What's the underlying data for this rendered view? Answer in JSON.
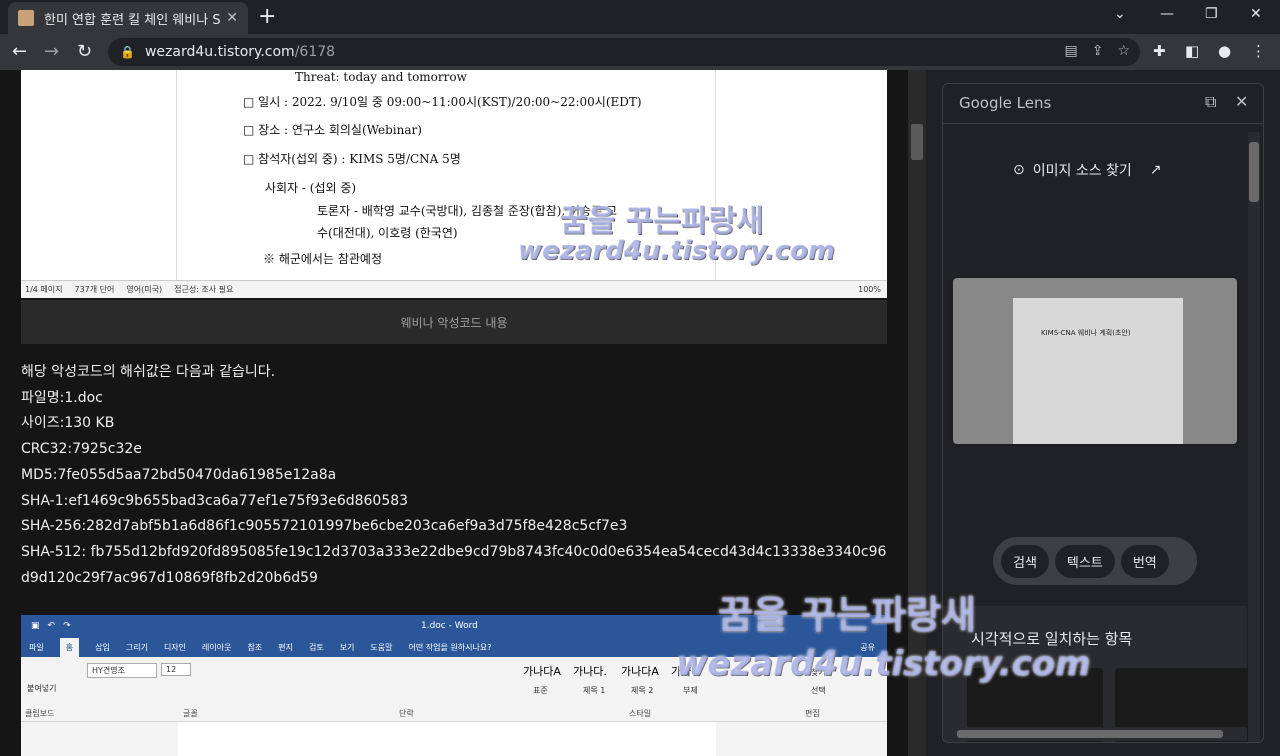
{
  "browser": {
    "tab_title": "한미 연합 훈련 킬 체인 웨비나 S",
    "url_host": "wezard4u.tistory.com",
    "url_path": "/6178"
  },
  "doc_screenshot": {
    "lines": [
      "Threat: today and tomorrow",
      "□ 일시 : 2022. 9/10일 중 09:00~11:00시(KST)/20:00~22:00시(EDT)",
      "□ 장소 : 연구소 회의실(Webinar)",
      "□ 참석자(섭외 중) : KIMS 5명/CNA 5명",
      "사회자 - (섭외 중)",
      "토론자 - 배학영 교수(국방대), 김종철 준장(합참), 이승주 교",
      "수(대전대), 이호령 (한국연)",
      "※ 해군에서는 참관예정"
    ],
    "status_items": [
      "1/4 페이지",
      "737개 단어",
      "영어(미국)",
      "접근성: 조사 필요",
      "100%"
    ]
  },
  "caption": "웨비나 악성코드 내용",
  "hash_info": {
    "intro": "해당 악성코드의 해쉬값은 다음과 같습니다.",
    "filename": "파일명:1.doc",
    "size": "사이즈:130 KB",
    "crc32": "CRC32:7925c32e",
    "md5": "MD5:7fe055d5aa72bd50470da61985e12a8a",
    "sha1": "SHA-1:ef1469c9b655bad3ca6a77ef1e75f93e6d860583",
    "sha256": "SHA-256:282d7abf5b1a6d86f1c905572101997be6cbe203ca6ef9a3d75f8e428c5cf7e3",
    "sha512": "SHA-512:  fb755d12bfd920fd895085fe19c12d3703a333e22dbe9cd79b8743fc40c0d0e6354ea54cecd43d4c13338e3340c96d9d120c29f7ac967d10869f8fb2d20b6d59"
  },
  "word_screenshot": {
    "title": "1.doc - Word",
    "tabs": [
      "파일",
      "홈",
      "삽입",
      "그리기",
      "디자인",
      "레이아웃",
      "참조",
      "편지",
      "검토",
      "보기",
      "도움말",
      "어떤 작업을 원하시나요?"
    ],
    "active_tab": "홈",
    "share": "공유",
    "font_name": "HY견명조",
    "font_size": "12",
    "paste_label": "붙여넣기",
    "groups": [
      "클립보드",
      "글꼴",
      "단락",
      "스타일",
      "편집"
    ],
    "styles": [
      "가나다A",
      "가나다.",
      "가나다A",
      "가나다"
    ],
    "style_names": [
      "표준",
      "제목 1",
      "제목 2",
      "부제"
    ],
    "find": "찾기",
    "select": "선택"
  },
  "lens": {
    "title": "Google Lens",
    "find_source": "이미지 소스 찾기",
    "thumb_title": "KIMS-CNA 웨비나 계획(초안)",
    "chips": [
      "검색",
      "텍스트",
      "번역"
    ],
    "visual_matches": "시각적으로 일치하는 항목"
  },
  "watermark": {
    "line1": "꿈을 꾸는파랑새",
    "line2": "wezard4u.tistory.com"
  }
}
